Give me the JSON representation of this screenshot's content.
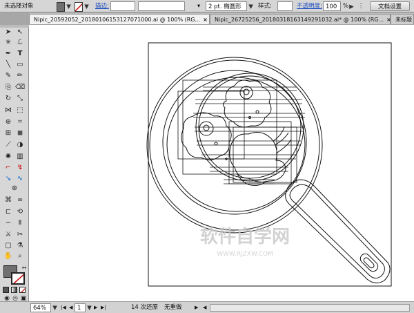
{
  "control_bar": {
    "selection_label": "未选择对象",
    "stroke_label": "描边:",
    "stroke_weight": "2 pt. 椭圆形",
    "style_label": "样式:",
    "opacity_label": "不透明度:",
    "opacity_value": "100",
    "opacity_unit": "%",
    "doc_setup_button": "文档设置",
    "icons": {
      "fill": "fill-swatch-icon",
      "stroke": "stroke-swatch-icon",
      "brush": "brush-icon",
      "style": "graphic-style-icon",
      "more": "more-options-icon"
    },
    "colors": {
      "fill_swatch": "#6f6f6f",
      "stroke_swatch": "#ffffff"
    }
  },
  "tabs": [
    {
      "label": "Nipic_20592052_20180106153127071000.ai @ 100% (RG...",
      "close": "×",
      "active": true
    },
    {
      "label": "Nipic_26725256_20180318163149291032.ai* @ 100% (RG...",
      "close": "×",
      "active": false
    },
    {
      "label": "未标题",
      "close": "",
      "active": false
    }
  ],
  "watermark": {
    "line1": "软件自学网",
    "line2": "WWW.RJZXW.COM"
  },
  "status_bar": {
    "zoom": "64%",
    "artboard": "1",
    "history": "14 次还原",
    "redo": "无重做",
    "nav_first": "|◀",
    "nav_prev": "◀",
    "nav_next": "▶",
    "nav_last": "▶|",
    "play": "▶",
    "scroll_left": "◀"
  },
  "tools": {
    "fill_color": "#6f6f6f",
    "stroke_color": "#ffffff",
    "none_color": "#cc0000"
  }
}
